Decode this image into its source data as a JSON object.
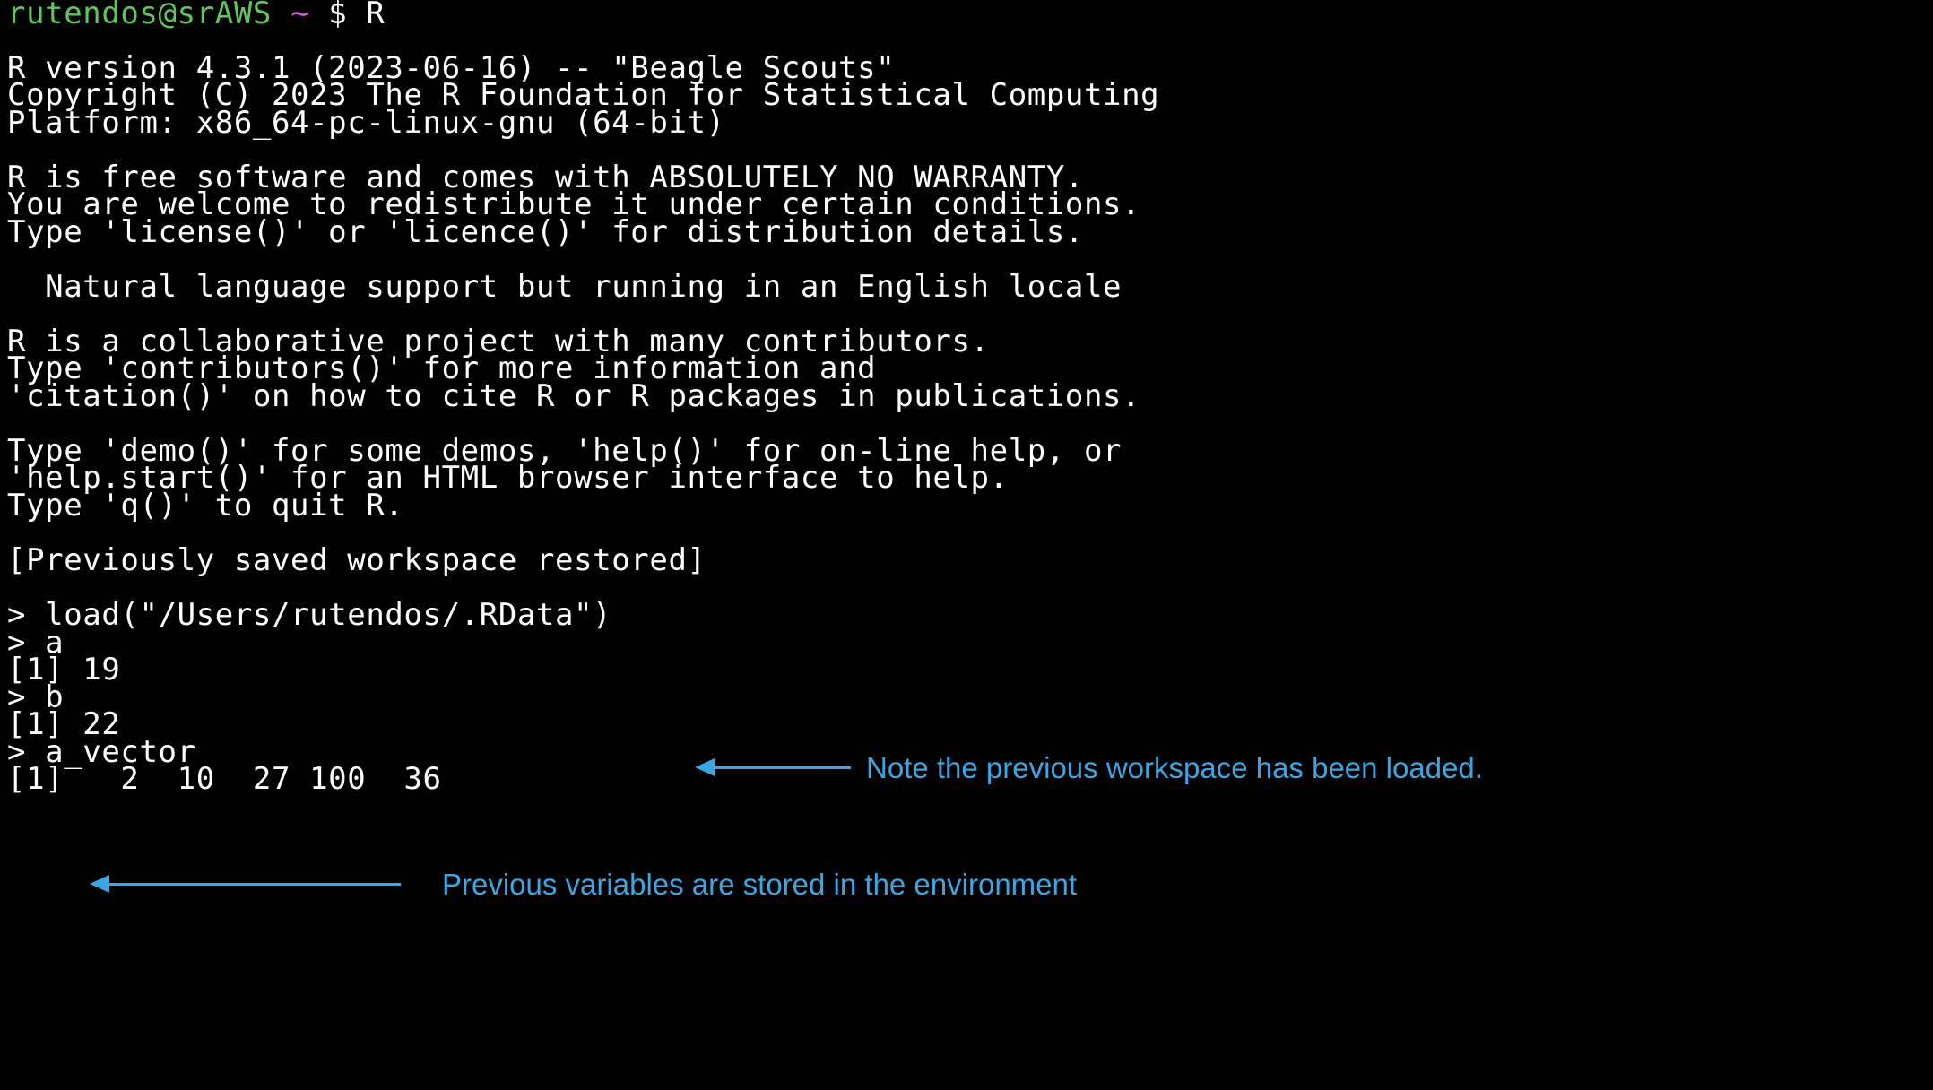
{
  "prompt": {
    "user_host": "rutendos@srAWS",
    "cwd": "~",
    "symbol": "$",
    "command": "R"
  },
  "banner": [
    "R version 4.3.1 (2023-06-16) -- \"Beagle Scouts\"",
    "Copyright (C) 2023 The R Foundation for Statistical Computing",
    "Platform: x86_64-pc-linux-gnu (64-bit)",
    "R is free software and comes with ABSOLUTELY NO WARRANTY.",
    "You are welcome to redistribute it under certain conditions.",
    "Type 'license()' or 'licence()' for distribution details.",
    "  Natural language support but running in an English locale",
    "R is a collaborative project with many contributors.",
    "Type 'contributors()' for more information and",
    "'citation()' on how to cite R or R packages in publications.",
    "Type 'demo()' for some demos, 'help()' for on-line help, or",
    "'help.start()' for an HTML browser interface to help.",
    "Type 'q()' to quit R.",
    "[Previously saved workspace restored]"
  ],
  "session": [
    "> load(\"/Users/rutendos/.RData\")",
    "> a",
    "[1] 19",
    "> b",
    "[1] 22",
    "> a_vector",
    "[1]   2  10  27 100  36"
  ],
  "annotations": {
    "workspace_note": "Note the previous workspace has been loaded.",
    "variables_note": "Previous variables are stored in the environment"
  },
  "colors": {
    "background": "#000000",
    "text": "#ffffff",
    "user_host": "#5fc65a",
    "tilde": "#d05ad8",
    "annotation": "#3aa6e3"
  }
}
